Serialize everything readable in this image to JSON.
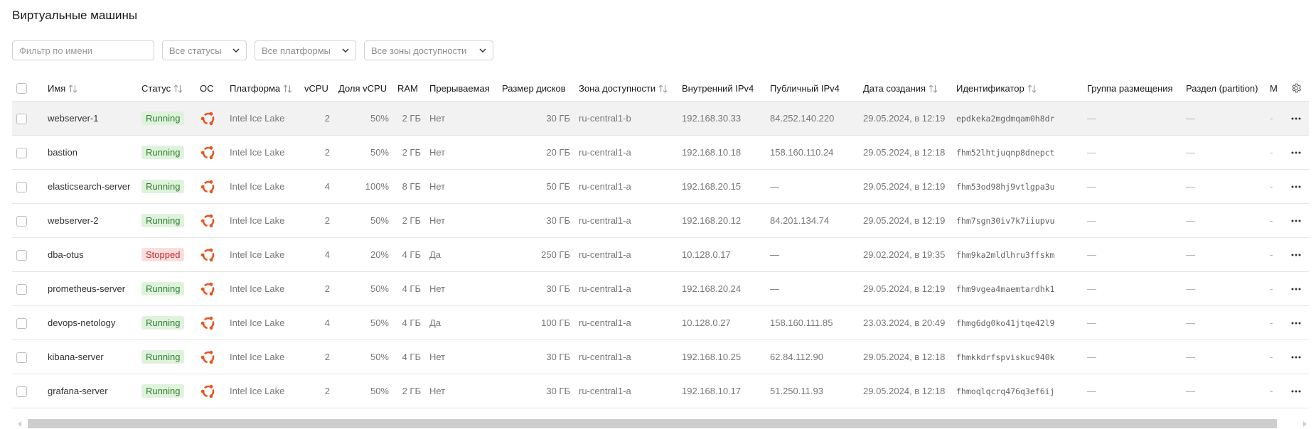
{
  "page": {
    "title": "Виртуальные машины"
  },
  "filters": {
    "name_placeholder": "Фильтр по имени",
    "status_select": "Все статусы",
    "platform_select": "Все платформы",
    "zone_select": "Все зоны доступности"
  },
  "table": {
    "columns": {
      "name": "Имя",
      "status": "Статус",
      "os": "ОС",
      "platform": "Платформа",
      "vcpu": "vCPU",
      "vcpu_share": "Доля vCPU",
      "ram": "RAM",
      "preemptible": "Прерываемая",
      "disk_size": "Размер дисков",
      "zone": "Зона доступности",
      "internal_ip": "Внутренний IPv4",
      "public_ip": "Публичный IPv4",
      "created": "Дата создания",
      "id": "Идентификатор",
      "placement_group": "Группа размещения",
      "partition": "Раздел (partition)",
      "truncated": "М"
    },
    "rows": [
      {
        "name": "webserver-1",
        "status": "Running",
        "platform": "Intel Ice Lake",
        "vcpu": "2",
        "vcpu_share": "50%",
        "ram": "2 ГБ",
        "preemptible": "Нет",
        "disk": "30 ГБ",
        "zone": "ru-central1-b",
        "internal_ip": "192.168.30.33",
        "public_ip": "84.252.140.220",
        "created": "29.05.2024, в 12:19",
        "id": "epdkeka2mgdmqam0h8dr",
        "placement_group": "—",
        "partition": "—",
        "extra": "-"
      },
      {
        "name": "bastion",
        "status": "Running",
        "platform": "Intel Ice Lake",
        "vcpu": "2",
        "vcpu_share": "50%",
        "ram": "2 ГБ",
        "preemptible": "Нет",
        "disk": "20 ГБ",
        "zone": "ru-central1-a",
        "internal_ip": "192.168.10.18",
        "public_ip": "158.160.110.24",
        "created": "29.05.2024, в 12:18",
        "id": "fhm52lhtjuqnp8dnepct",
        "placement_group": "—",
        "partition": "—",
        "extra": "-"
      },
      {
        "name": "elasticsearch-server",
        "status": "Running",
        "platform": "Intel Ice Lake",
        "vcpu": "4",
        "vcpu_share": "100%",
        "ram": "8 ГБ",
        "preemptible": "Нет",
        "disk": "50 ГБ",
        "zone": "ru-central1-a",
        "internal_ip": "192.168.20.15",
        "public_ip": "—",
        "created": "29.05.2024, в 12:19",
        "id": "fhm53od98hj9vtlgpa3u",
        "placement_group": "—",
        "partition": "—",
        "extra": "-"
      },
      {
        "name": "webserver-2",
        "status": "Running",
        "platform": "Intel Ice Lake",
        "vcpu": "2",
        "vcpu_share": "50%",
        "ram": "2 ГБ",
        "preemptible": "Нет",
        "disk": "30 ГБ",
        "zone": "ru-central1-a",
        "internal_ip": "192.168.20.12",
        "public_ip": "84.201.134.74",
        "created": "29.05.2024, в 12:19",
        "id": "fhm7sgn30iv7k7iiupvu",
        "placement_group": "—",
        "partition": "—",
        "extra": "-"
      },
      {
        "name": "dba-otus",
        "status": "Stopped",
        "platform": "Intel Ice Lake",
        "vcpu": "4",
        "vcpu_share": "20%",
        "ram": "4 ГБ",
        "preemptible": "Да",
        "disk": "250 ГБ",
        "zone": "ru-central1-a",
        "internal_ip": "10.128.0.17",
        "public_ip": "—",
        "created": "29.02.2024, в 19:35",
        "id": "fhm9ka2mldlhru3ffskm",
        "placement_group": "—",
        "partition": "—",
        "extra": "-"
      },
      {
        "name": "prometheus-server",
        "status": "Running",
        "platform": "Intel Ice Lake",
        "vcpu": "2",
        "vcpu_share": "50%",
        "ram": "4 ГБ",
        "preemptible": "Нет",
        "disk": "30 ГБ",
        "zone": "ru-central1-a",
        "internal_ip": "192.168.20.24",
        "public_ip": "—",
        "created": "29.05.2024, в 12:19",
        "id": "fhm9vgea4maemtardhk1",
        "placement_group": "—",
        "partition": "—",
        "extra": "-"
      },
      {
        "name": "devops-netology",
        "status": "Running",
        "platform": "Intel Ice Lake",
        "vcpu": "4",
        "vcpu_share": "50%",
        "ram": "4 ГБ",
        "preemptible": "Да",
        "disk": "100 ГБ",
        "zone": "ru-central1-a",
        "internal_ip": "10.128.0.27",
        "public_ip": "158.160.111.85",
        "created": "23.03.2024, в 20:49",
        "id": "fhmg6dg0ko41jtqe42l9",
        "placement_group": "—",
        "partition": "—",
        "extra": "-"
      },
      {
        "name": "kibana-server",
        "status": "Running",
        "platform": "Intel Ice Lake",
        "vcpu": "2",
        "vcpu_share": "50%",
        "ram": "4 ГБ",
        "preemptible": "Нет",
        "disk": "30 ГБ",
        "zone": "ru-central1-a",
        "internal_ip": "192.168.10.25",
        "public_ip": "62.84.112.90",
        "created": "29.05.2024, в 12:18",
        "id": "fhmkkdrfspviskuc940k",
        "placement_group": "—",
        "partition": "—",
        "extra": "-"
      },
      {
        "name": "grafana-server",
        "status": "Running",
        "platform": "Intel Ice Lake",
        "vcpu": "2",
        "vcpu_share": "50%",
        "ram": "2 ГБ",
        "preemptible": "Нет",
        "disk": "30 ГБ",
        "zone": "ru-central1-a",
        "internal_ip": "192.168.10.17",
        "public_ip": "51.250.11.93",
        "created": "29.05.2024, в 12:18",
        "id": "fhmoqlqcrq476q3ef6ij",
        "placement_group": "—",
        "partition": "—",
        "extra": "-"
      }
    ]
  },
  "icons": {
    "os": "ubuntu-icon",
    "sort": "sort-arrows-icon",
    "settings": "gear-icon",
    "row_actions": "more-horizontal-icon",
    "dropdown": "chevron-down-icon"
  },
  "colors": {
    "running_bg": "#dff3dc",
    "running_text": "#2f7d32",
    "stopped_bg": "#fbdede",
    "stopped_text": "#c62828",
    "ubuntu": "#e95420"
  }
}
